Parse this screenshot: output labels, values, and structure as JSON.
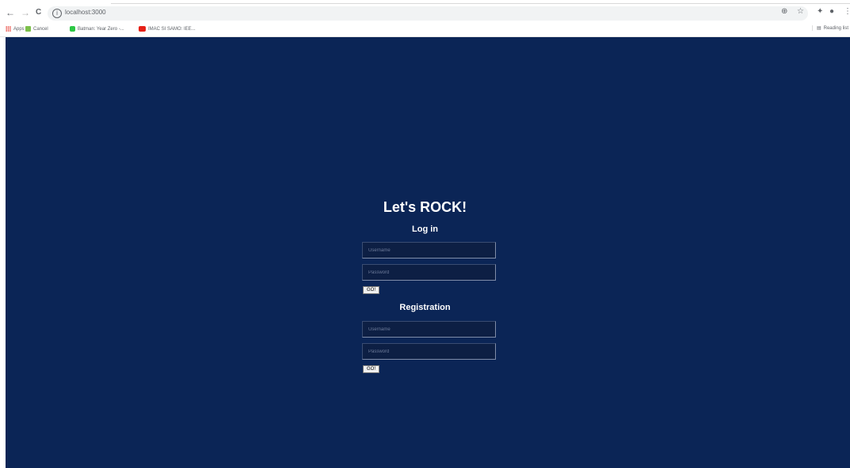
{
  "browser": {
    "url": "localhost:3000",
    "back_glyph": "←",
    "forward_glyph": "→",
    "reload_glyph": "C",
    "reading_list": "Reading list",
    "bookmarks": [
      {
        "label": "Apps",
        "icon": "apps-grid-icon"
      },
      {
        "label": "Cancel",
        "icon": "folder-icon"
      },
      {
        "label": "Batman: Year Zero -...",
        "icon": "green-favicon"
      },
      {
        "label": "IMAC SI SAMO: IEE...",
        "icon": "youtube-icon"
      }
    ]
  },
  "page": {
    "heading": "Let's ROCK!",
    "login": {
      "title": "Log in",
      "username_placeholder": "Username",
      "password_placeholder": "Password",
      "submit": "GO!"
    },
    "registration": {
      "title": "Registration",
      "username_placeholder": "Username",
      "password_placeholder": "Password",
      "submit": "GO!"
    }
  },
  "colors": {
    "background": "#0b2556",
    "input_background": "#0d1f44",
    "text": "#ffffff"
  }
}
